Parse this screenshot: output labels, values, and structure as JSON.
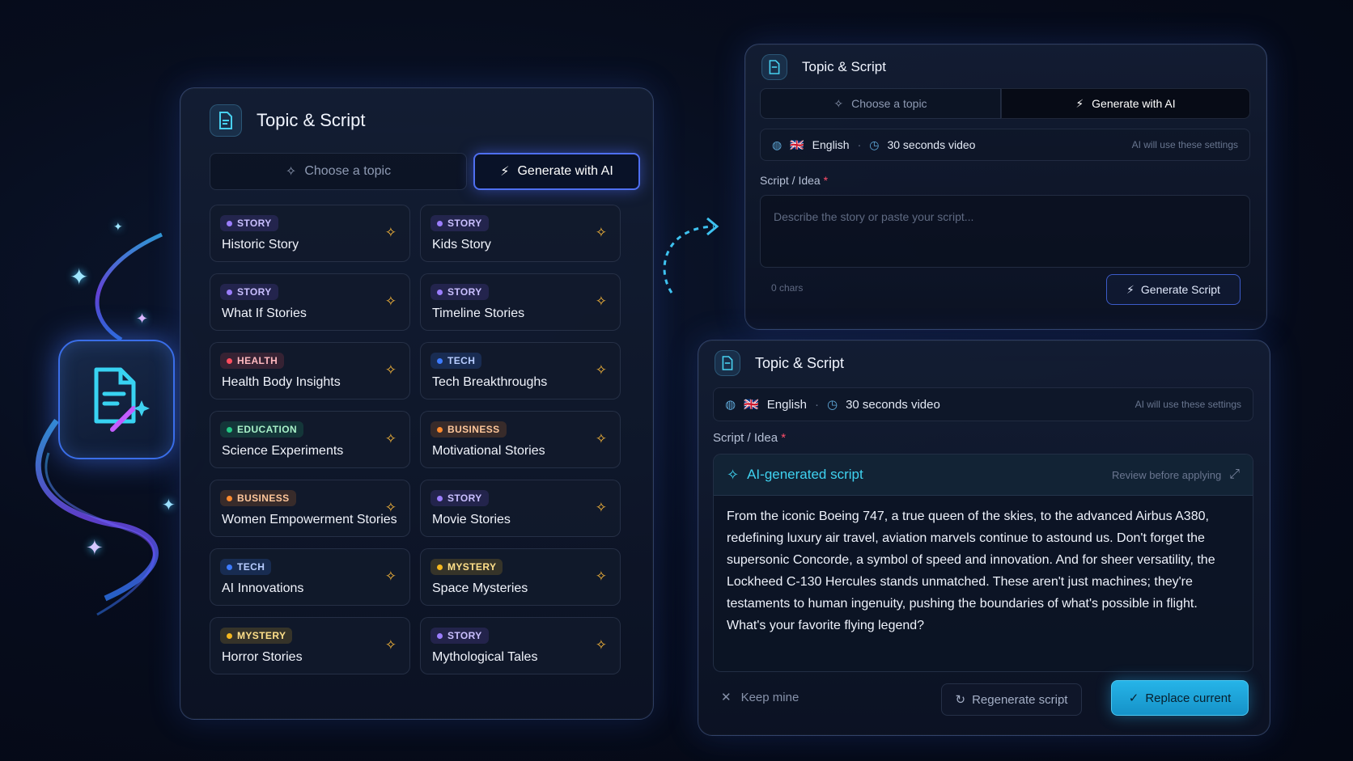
{
  "panel_title": "Topic & Script",
  "tabs": {
    "choose": "Choose a topic",
    "generate": "Generate with AI"
  },
  "topics": [
    {
      "badge": "STORY",
      "kind": "story",
      "title": "Historic Story"
    },
    {
      "badge": "STORY",
      "kind": "story",
      "title": "Kids Story"
    },
    {
      "badge": "STORY",
      "kind": "story",
      "title": "What If Stories"
    },
    {
      "badge": "STORY",
      "kind": "story",
      "title": "Timeline Stories"
    },
    {
      "badge": "HEALTH",
      "kind": "health",
      "title": "Health Body Insights"
    },
    {
      "badge": "TECH",
      "kind": "tech",
      "title": "Tech Breakthroughs"
    },
    {
      "badge": "EDUCATION",
      "kind": "education",
      "title": "Science Experiments"
    },
    {
      "badge": "BUSINESS",
      "kind": "business",
      "title": "Motivational Stories"
    },
    {
      "badge": "BUSINESS",
      "kind": "business",
      "title": "Women Empowerment Stories"
    },
    {
      "badge": "STORY",
      "kind": "story",
      "title": "Movie Stories"
    },
    {
      "badge": "TECH",
      "kind": "tech",
      "title": "AI Innovations"
    },
    {
      "badge": "MYSTERY",
      "kind": "mystery",
      "title": "Space Mysteries"
    },
    {
      "badge": "MYSTERY",
      "kind": "mystery",
      "title": "Horror Stories"
    },
    {
      "badge": "STORY",
      "kind": "story",
      "title": "Mythological Tales"
    }
  ],
  "settings": {
    "language": "English",
    "flag": "🇬🇧",
    "duration": "30 seconds video",
    "hint": "AI will use these settings",
    "separator": "·"
  },
  "script": {
    "label": "Script / Idea",
    "required_mark": "*",
    "placeholder": "Describe the story or paste your script...",
    "char_count": "0 chars",
    "generate_button": "Generate Script"
  },
  "ai_result": {
    "title": "AI-generated script",
    "review_hint": "Review before applying",
    "text": "From the iconic Boeing 747, a true queen of the skies, to the advanced Airbus A380, redefining luxury air travel, aviation marvels continue to astound us. Don't forget the supersonic Concorde, a symbol of speed and innovation. And for sheer versatility, the Lockheed C-130 Hercules stands unmatched. These aren't just machines; they're testaments to human ingenuity, pushing the boundaries of what's possible in flight. What's your favorite flying legend?",
    "keep_label": "Keep mine",
    "regenerate_label": "Regenerate script",
    "replace_label": "Replace current"
  },
  "colors": {
    "accent_blue": "#4f6ff0",
    "accent_cyan": "#26b4e8",
    "spark_gold": "#f4b43a"
  },
  "icons": [
    "document-icon",
    "sparkle-icon",
    "magic-wand-icon",
    "globe-icon",
    "clock-icon",
    "expand-icon",
    "close-icon",
    "refresh-icon",
    "check-circle-icon",
    "arrow-icon"
  ]
}
